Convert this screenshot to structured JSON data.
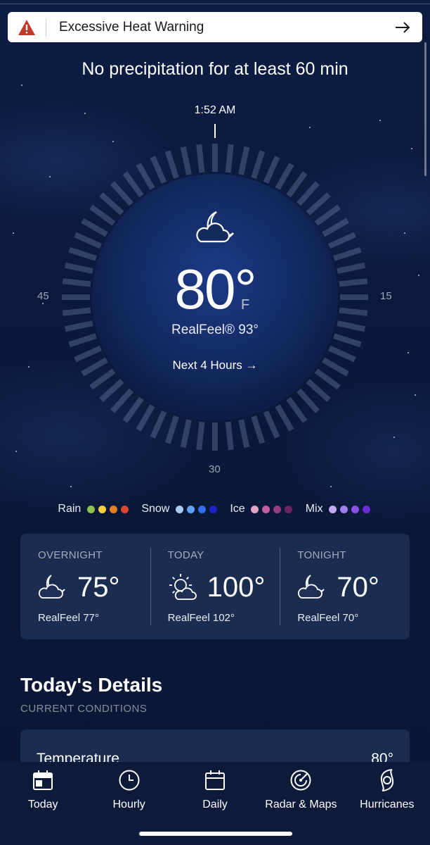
{
  "alert": {
    "text": "Excessive Heat Warning"
  },
  "minutecast": {
    "summary": "No precipitation for at least 60 min",
    "time": "1:52 AM",
    "minute_labels": {
      "left": "45",
      "right": "15",
      "bottom": "30"
    }
  },
  "current": {
    "temperature": "80°",
    "unit": "F",
    "realfeel": "RealFeel® 93°",
    "next_link": "Next 4 Hours →",
    "icon": "moon-cloud-icon"
  },
  "legend": {
    "groups": [
      {
        "label": "Rain",
        "colors": [
          "#8bc34a",
          "#f4d03f",
          "#e67e22",
          "#d9472b"
        ]
      },
      {
        "label": "Snow",
        "colors": [
          "#a9cbf2",
          "#5da3f0",
          "#2f6ff0",
          "#1a24c8"
        ]
      },
      {
        "label": "Ice",
        "colors": [
          "#e2a3c6",
          "#c65ca0",
          "#9c3a86",
          "#6d2464"
        ]
      },
      {
        "label": "Mix",
        "colors": [
          "#c4a8f3",
          "#a07ef0",
          "#8a50ee",
          "#6a2bd8"
        ]
      }
    ]
  },
  "forecast": [
    {
      "period": "OVERNIGHT",
      "temp": "75°",
      "realfeel": "RealFeel 77°",
      "icon": "moon-cloud-icon"
    },
    {
      "period": "TODAY",
      "temp": "100°",
      "realfeel": "RealFeel 102°",
      "icon": "sun-cloud-icon"
    },
    {
      "period": "TONIGHT",
      "temp": "70°",
      "realfeel": "RealFeel 70°",
      "icon": "moon-cloud-icon"
    }
  ],
  "details": {
    "title": "Today's Details",
    "subtitle": "CURRENT CONDITIONS",
    "rows": [
      {
        "label": "Temperature",
        "value": "80°"
      }
    ]
  },
  "tabs": [
    {
      "label": "Today",
      "icon": "calendar-today-icon"
    },
    {
      "label": "Hourly",
      "icon": "clock-icon"
    },
    {
      "label": "Daily",
      "icon": "calendar-icon"
    },
    {
      "label": "Radar & Maps",
      "icon": "radar-icon"
    },
    {
      "label": "Hurricanes",
      "icon": "hurricane-icon"
    }
  ],
  "colors": {
    "background": "#0b1a3c",
    "card": "#1e3056",
    "alert_icon": "#c0392b"
  }
}
